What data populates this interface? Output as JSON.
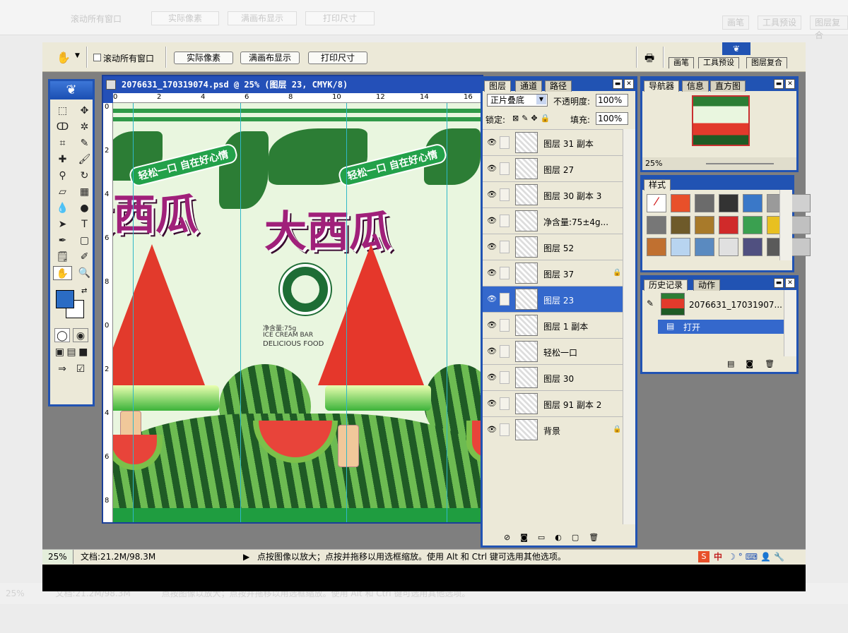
{
  "background_ui": {
    "options": {
      "scroll_all": "滚动所有窗口",
      "actual_pixels": "实际像素",
      "fit_screen": "满画布显示",
      "print_size": "打印尺寸"
    },
    "tabs": [
      "画笔",
      "工具预设",
      "图层复合"
    ],
    "zoom": "25%",
    "doc_size": "文档:21.2M/98.3M",
    "hint": "点按图像以放大；点按并拖移以用选框缩放。使用 Alt 和 Ctrl 键可选用其他选项。"
  },
  "options_bar": {
    "scroll_all_label": "滚动所有窗口",
    "actual_pixels": "实际像素",
    "fit_screen": "满画布显示",
    "print_size": "打印尺寸"
  },
  "palette_well": {
    "tabs": [
      "画笔",
      "工具预设",
      "图层复合"
    ]
  },
  "document": {
    "title": "2076631_170319074.psd @ 25% (图层 23, CMYK/8)",
    "ruler_h": [
      "0",
      "2",
      "4",
      "6",
      "8",
      "10",
      "12",
      "14",
      "16"
    ],
    "ruler_v": [
      "0",
      "2",
      "4",
      "6",
      "8",
      "0",
      "2",
      "4",
      "6",
      "8"
    ],
    "artwork": {
      "brand": "大西瓜",
      "slogan": "轻松一口 自在好心情",
      "net_weight": "净含量:75g",
      "line1": "ICE CREAM BAR",
      "line2": "DELICIOUS FOOD"
    }
  },
  "layers_panel": {
    "tabs": [
      "图层",
      "通道",
      "路径"
    ],
    "blend_mode": "正片叠底",
    "opacity_label": "不透明度:",
    "opacity": "100%",
    "lock_label": "锁定:",
    "fill_label": "填充:",
    "fill": "100%",
    "layers": [
      {
        "name": "图层 31 副本",
        "selected": false,
        "locked": false
      },
      {
        "name": "图层 27",
        "selected": false,
        "locked": false
      },
      {
        "name": "图层 30 副本 3",
        "selected": false,
        "locked": false
      },
      {
        "name": "净含量:75±4g...",
        "selected": false,
        "locked": false
      },
      {
        "name": "图层 52",
        "selected": false,
        "locked": false
      },
      {
        "name": "图层 37",
        "selected": false,
        "locked": true
      },
      {
        "name": "图层 23",
        "selected": true,
        "locked": false
      },
      {
        "name": "图层 1 副本",
        "selected": false,
        "locked": false
      },
      {
        "name": "轻松一口",
        "selected": false,
        "locked": false
      },
      {
        "name": "图层 30",
        "selected": false,
        "locked": false
      },
      {
        "name": "图层 91 副本 2",
        "selected": false,
        "locked": false
      },
      {
        "name": "背景",
        "selected": false,
        "locked": true
      }
    ]
  },
  "navigator_panel": {
    "tabs": [
      "导航器",
      "信息",
      "直方图"
    ],
    "zoom": "25%"
  },
  "styles_panel": {
    "tab": "样式",
    "swatches": [
      "#ffffff",
      "#e8502a",
      "#6b6b6b",
      "#333333",
      "#3a78c8",
      "#9a9a9a",
      "#d0d0d0",
      "#777777",
      "#6e5a2a",
      "#a87a2a",
      "#d02a2a",
      "#3aa050",
      "#e8c020",
      "#c0c0c0",
      "#c07030",
      "#b8d4f0",
      "#5a8ac0",
      "#e0e0e0",
      "#505080",
      "#5a5a5a",
      "#c8c8c8"
    ]
  },
  "history_panel": {
    "tabs": [
      "历史记录",
      "动作"
    ],
    "snapshot": "2076631_17031907...",
    "step": "打开"
  },
  "status_bar": {
    "zoom": "25%",
    "doc_size": "文档:21.2M/98.3M",
    "hint": "点按图像以放大；点按并拖移以用选框缩放。使用 Alt 和 Ctrl 键可选用其他选项。",
    "ime": "中"
  },
  "colors": {
    "accent": "#2153b3",
    "selection": "#3468cc",
    "chrome": "#ece9d8",
    "foreground": "#2b6cc4"
  }
}
